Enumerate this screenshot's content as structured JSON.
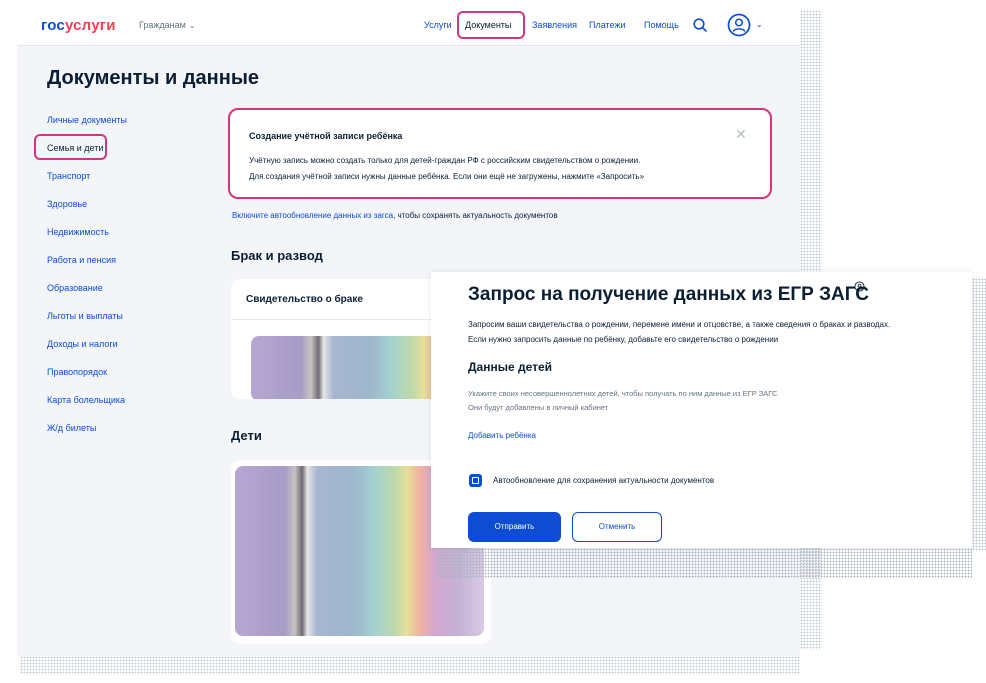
{
  "header": {
    "logo_part1": "гос",
    "logo_part2": "услуги",
    "audience": "Гражданам",
    "nav": {
      "services": "Услуги",
      "documents": "Документы",
      "applications": "Заявления",
      "payments": "Платежи",
      "help": "Помощь"
    }
  },
  "page_title": "Документы и данные",
  "sidebar": {
    "items": [
      {
        "label": "Личные документы"
      },
      {
        "label": "Семья и дети"
      },
      {
        "label": "Транспорт"
      },
      {
        "label": "Здоровье"
      },
      {
        "label": "Недвижимость"
      },
      {
        "label": "Работа и пенсия"
      },
      {
        "label": "Образование"
      },
      {
        "label": "Льготы и выплаты"
      },
      {
        "label": "Доходы и налоги"
      },
      {
        "label": "Правопорядок"
      },
      {
        "label": "Карта болельщика"
      },
      {
        "label": "Ж/д билеты"
      }
    ]
  },
  "notice": {
    "title": "Создание учётной записи ребёнка",
    "line1": "Учётную запись можно создать только для детей-граждан РФ с российским свидетельством о рождении.",
    "line2": "Для создания учётной записи нужны данные ребёнка. Если они ещё не загружены, нажмите «Запросить»"
  },
  "autoupdate": {
    "link": "Включите автообновление данных из загса,",
    "rest": " чтобы сохранять актуальность документов"
  },
  "sections": {
    "marriage": "Брак и развод",
    "marriage_card": "Свидетельство о браке",
    "children": "Дети"
  },
  "dialog": {
    "title": "Запрос на получение данных из ЕГР ЗАГС",
    "text1": "Запросим ваши свидетельства о рождении, перемене имени и отцовстве, а также сведения о браках и разводах.",
    "text2": "Если нужно запросить данные по ребёнку, добавьте его свидетельство о рождении",
    "subtitle": "Данные детей",
    "hint1": "Укажите своих несовершеннолетних детей, чтобы получать по ним данные из ЕГР ЗАГС",
    "hint2": "Они будут добавлены в личный кабинет",
    "add_child": "Добавить ребёнка",
    "checkbox_label": "Автообновление для сохранения актуальности документов",
    "checkbox_checked": true,
    "submit": "Отправить",
    "cancel": "Отменить"
  },
  "colors": {
    "brand_blue": "#0d4cd3",
    "brand_red": "#ee3f58",
    "highlight": "#d1387a",
    "page_bg": "#f3f5f9"
  },
  "icons": {
    "search": "search-icon",
    "user": "user-icon",
    "close": "close-icon",
    "help": "help-icon",
    "chevron": "chevron-down-icon"
  }
}
